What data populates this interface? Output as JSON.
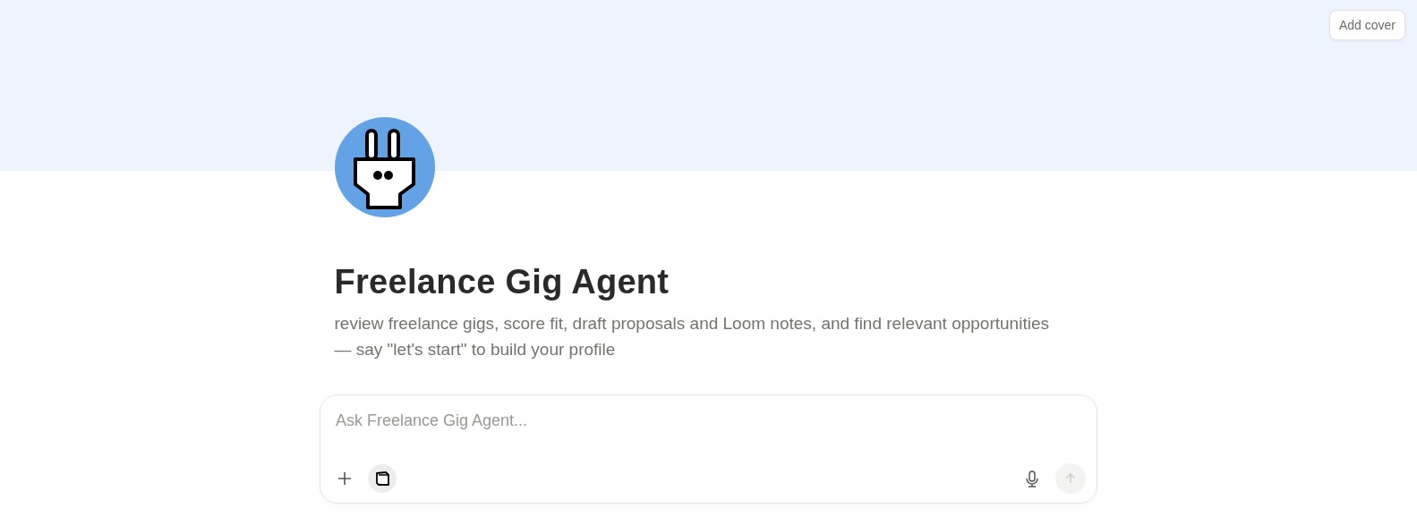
{
  "cover_button": "Add cover",
  "title": "Freelance Gig Agent",
  "description": "review freelance gigs, score fit, draft proposals and Loom notes, and find relevant opportunities — say \"let's start\" to build your profile",
  "chat": {
    "placeholder": "Ask Freelance Gig Agent...",
    "send_disabled": true
  }
}
